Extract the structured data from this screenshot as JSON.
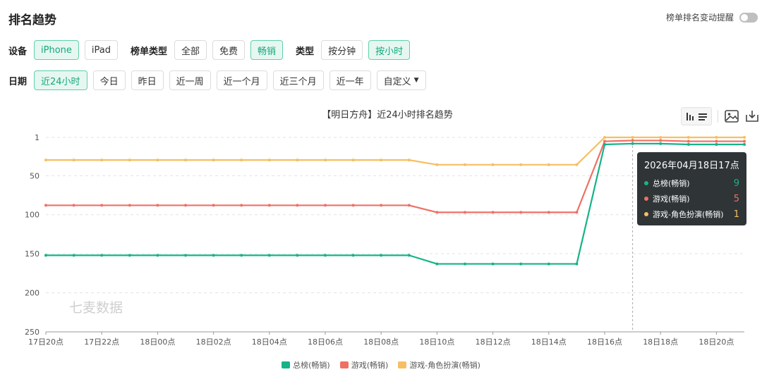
{
  "header": {
    "title": "排名趋势",
    "alert_label": "榜单排名变动提醒"
  },
  "filters": {
    "device_label": "设备",
    "devices": [
      {
        "label": "iPhone",
        "active": true
      },
      {
        "label": "iPad",
        "active": false
      }
    ],
    "list_type_label": "榜单类型",
    "list_types": [
      {
        "label": "全部",
        "active": false
      },
      {
        "label": "免费",
        "active": false
      },
      {
        "label": "畅销",
        "active": true
      }
    ],
    "type_label": "类型",
    "types": [
      {
        "label": "按分钟",
        "active": false
      },
      {
        "label": "按小时",
        "active": true
      }
    ],
    "date_label": "日期",
    "dates": [
      {
        "label": "近24小时",
        "active": true
      },
      {
        "label": "今日",
        "active": false
      },
      {
        "label": "昨日",
        "active": false
      },
      {
        "label": "近一周",
        "active": false
      },
      {
        "label": "近一个月",
        "active": false
      },
      {
        "label": "近三个月",
        "active": false
      },
      {
        "label": "近一年",
        "active": false
      }
    ],
    "custom_label": "自定义"
  },
  "watermark": "七麦数据",
  "tooltip": {
    "title": "2026年04月18日17点",
    "rows": [
      {
        "name": "总榜(畅销)",
        "value": "9",
        "color": "#15b387"
      },
      {
        "name": "游戏(畅销)",
        "value": "5",
        "color": "#ee7065"
      },
      {
        "name": "游戏-角色扮演(畅销)",
        "value": "1",
        "color": "#f6bf62"
      }
    ]
  },
  "chart_data": {
    "type": "line",
    "title": "【明日方舟】近24小时排名趋势",
    "x": [
      "17日20点",
      "17日21点",
      "17日22点",
      "17日23点",
      "18日00点",
      "18日01点",
      "18日02点",
      "18日03点",
      "18日04点",
      "18日05点",
      "18日06点",
      "18日07点",
      "18日08点",
      "18日09点",
      "18日10点",
      "18日11点",
      "18日12点",
      "18日13点",
      "18日14点",
      "18日15点",
      "18日16点",
      "18日17点",
      "18日18点",
      "18日19点",
      "18日20点",
      "18日21点"
    ],
    "x_tick_labels": [
      "17日20点",
      "17日22点",
      "18日00点",
      "18日02点",
      "18日04点",
      "18日06点",
      "18日08点",
      "18日10点",
      "18日12点",
      "18日14点",
      "18日16点",
      "18日18点",
      "18日20点"
    ],
    "y_ticks": [
      1,
      50,
      100,
      150,
      200,
      250
    ],
    "ylim": [
      1,
      250
    ],
    "y_inverted": true,
    "legend_position": "bottom",
    "highlight_x": "18日17点",
    "series": [
      {
        "name": "总榜(畅销)",
        "color": "#15b387",
        "values": [
          152,
          152,
          152,
          152,
          152,
          152,
          152,
          152,
          152,
          152,
          152,
          152,
          152,
          152,
          163,
          163,
          163,
          163,
          163,
          163,
          10,
          9,
          9,
          10,
          10,
          10
        ]
      },
      {
        "name": "游戏(畅销)",
        "color": "#ee7065",
        "values": [
          88,
          88,
          88,
          88,
          88,
          88,
          88,
          88,
          88,
          88,
          88,
          88,
          88,
          88,
          97,
          97,
          97,
          97,
          97,
          97,
          6,
          5,
          5,
          6,
          6,
          6
        ]
      },
      {
        "name": "游戏-角色扮演(畅销)",
        "color": "#f6bf62",
        "values": [
          30,
          30,
          30,
          30,
          30,
          30,
          30,
          30,
          30,
          30,
          30,
          30,
          30,
          30,
          36,
          36,
          36,
          36,
          36,
          36,
          1,
          1,
          1,
          1,
          1,
          1
        ]
      }
    ]
  }
}
